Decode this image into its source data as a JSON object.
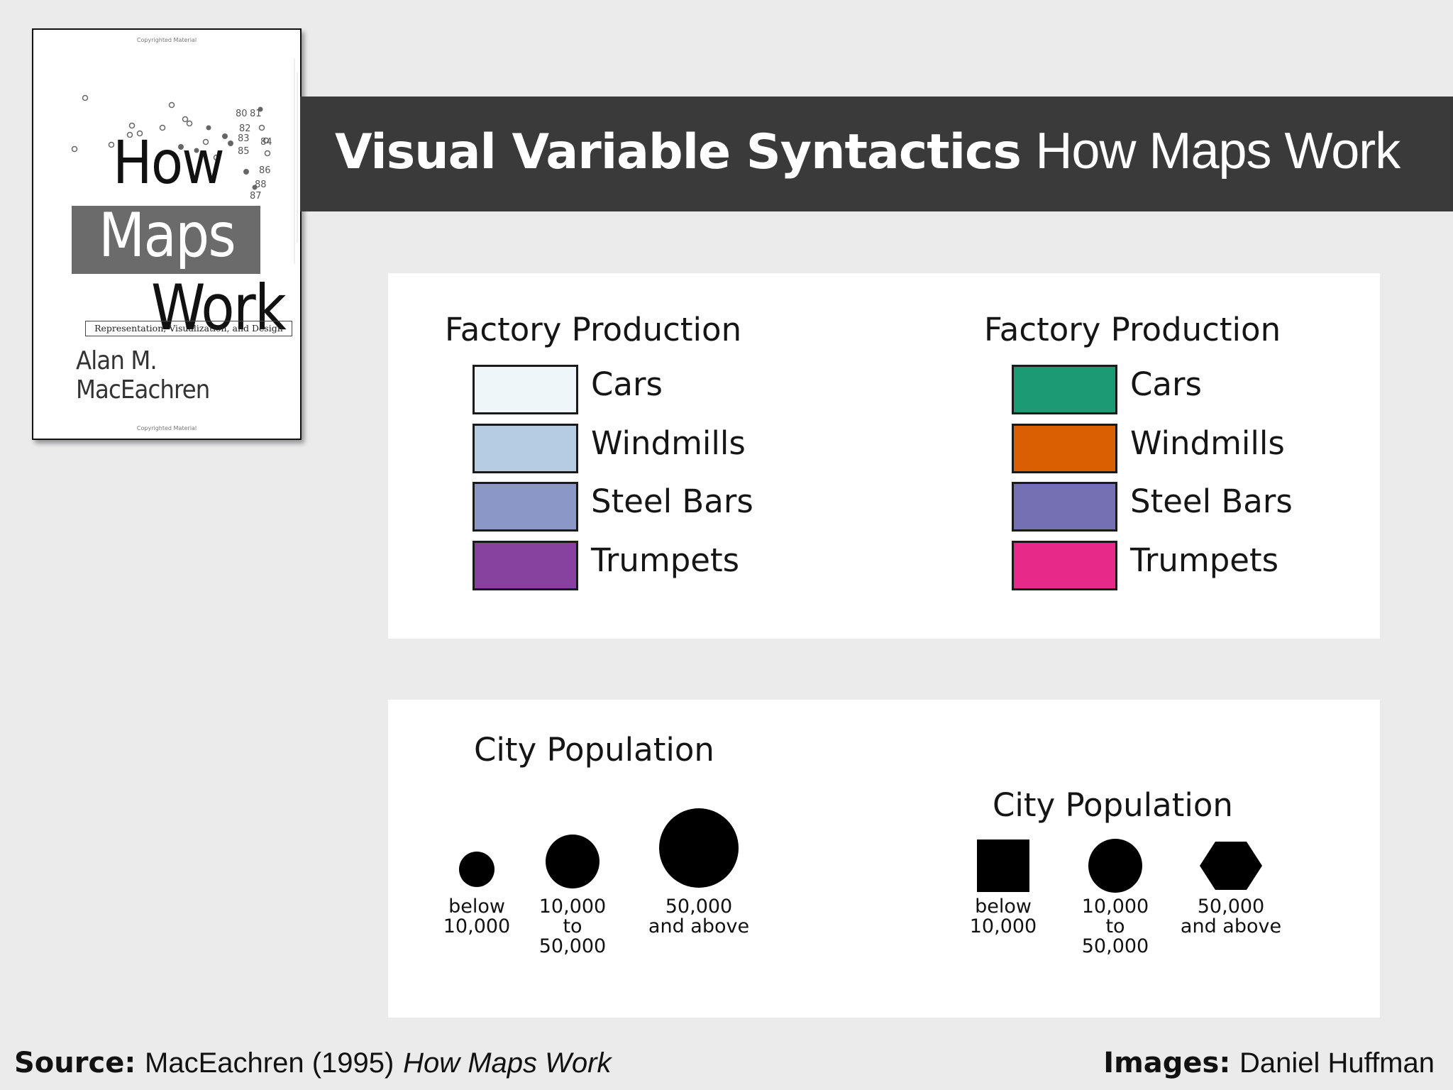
{
  "book": {
    "copyright_top": "Copyrighted Material",
    "copyright_bottom": "Copyrighted Material",
    "title_word1": "How",
    "title_word2": "Maps",
    "title_word3": "Work",
    "subtitle": "Representation, Visualization, and Design",
    "author": "Alan M. MacEachren",
    "numbers": [
      "80",
      "81",
      "82",
      "83",
      "84",
      "85",
      "86",
      "87",
      "88"
    ]
  },
  "header": {
    "title_bold": "Visual Variable Syntactics",
    "title_light": "How Maps Work"
  },
  "panel_top": {
    "left": {
      "title": "Factory Production",
      "items": [
        {
          "label": "Cars",
          "color": "#eef6f9"
        },
        {
          "label": "Windmills",
          "color": "#b4cde2"
        },
        {
          "label": "Steel Bars",
          "color": "#8b97c6"
        },
        {
          "label": "Trumpets",
          "color": "#8742a0"
        }
      ]
    },
    "right": {
      "title": "Factory Production",
      "items": [
        {
          "label": "Cars",
          "color": "#1b9a73"
        },
        {
          "label": "Windmills",
          "color": "#d95f02"
        },
        {
          "label": "Steel Bars",
          "color": "#7570b3"
        },
        {
          "label": "Trumpets",
          "color": "#e7298a"
        }
      ]
    }
  },
  "panel_bottom": {
    "left": {
      "title": "City Population",
      "symbols": [
        {
          "shape": "circle",
          "size": "small",
          "label": "below\n10,000"
        },
        {
          "shape": "circle",
          "size": "medium",
          "label": "10,000\nto\n50,000"
        },
        {
          "shape": "circle",
          "size": "large",
          "label": "50,000\nand above"
        }
      ]
    },
    "right": {
      "title": "City Population",
      "symbols": [
        {
          "shape": "square",
          "label": "below\n10,000"
        },
        {
          "shape": "circle",
          "label": "10,000\nto\n50,000"
        },
        {
          "shape": "hexagon",
          "label": "50,000\nand above"
        }
      ]
    }
  },
  "footer": {
    "source_label": "Source:",
    "source_text": "MacEachren (1995)",
    "source_title": "How Maps Work",
    "images_label": "Images:",
    "images_text": "Daniel Huffman"
  }
}
